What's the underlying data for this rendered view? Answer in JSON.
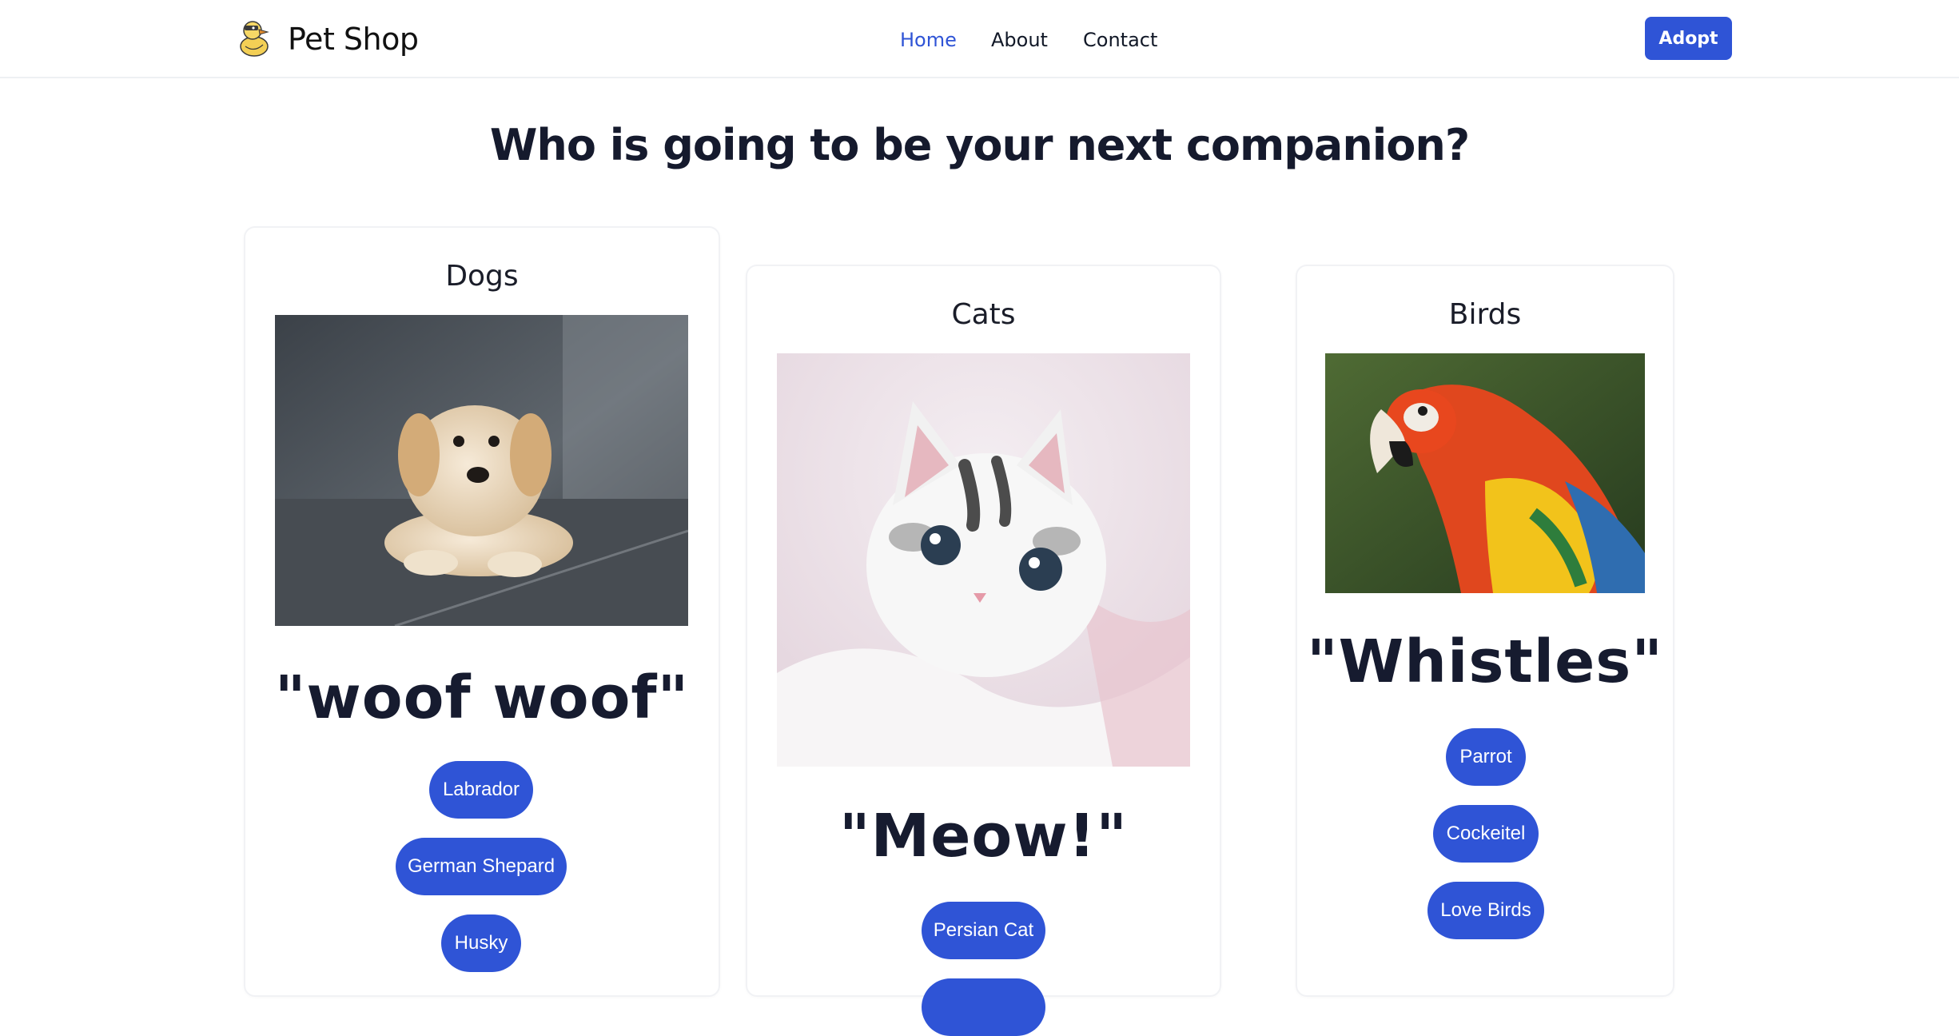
{
  "header": {
    "brand_icon": "duck-logo-icon",
    "brand_name": "Pet Shop",
    "nav": [
      {
        "label": "Home",
        "active": true
      },
      {
        "label": "About",
        "active": false
      },
      {
        "label": "Contact",
        "active": false
      }
    ],
    "cta_label": "Adopt"
  },
  "colors": {
    "accent": "#2f54d6",
    "heading": "#151a2d",
    "border": "#eef0f3"
  },
  "main": {
    "title": "Who is going to be your next companion?",
    "cards": [
      {
        "title": "Dogs",
        "image": "golden-retriever-puppy-photo",
        "sound": "\"woof woof\"",
        "breeds": [
          "Labrador",
          "German Shepard",
          "Husky"
        ]
      },
      {
        "title": "Cats",
        "image": "white-kitten-photo",
        "sound": "\"Meow!\"",
        "breeds": [
          "Persian Cat"
        ]
      },
      {
        "title": "Birds",
        "image": "macaw-parrot-photo",
        "sound": "\"Whistles\"",
        "breeds": [
          "Parrot",
          "Cockeitel",
          "Love Birds"
        ]
      }
    ]
  }
}
